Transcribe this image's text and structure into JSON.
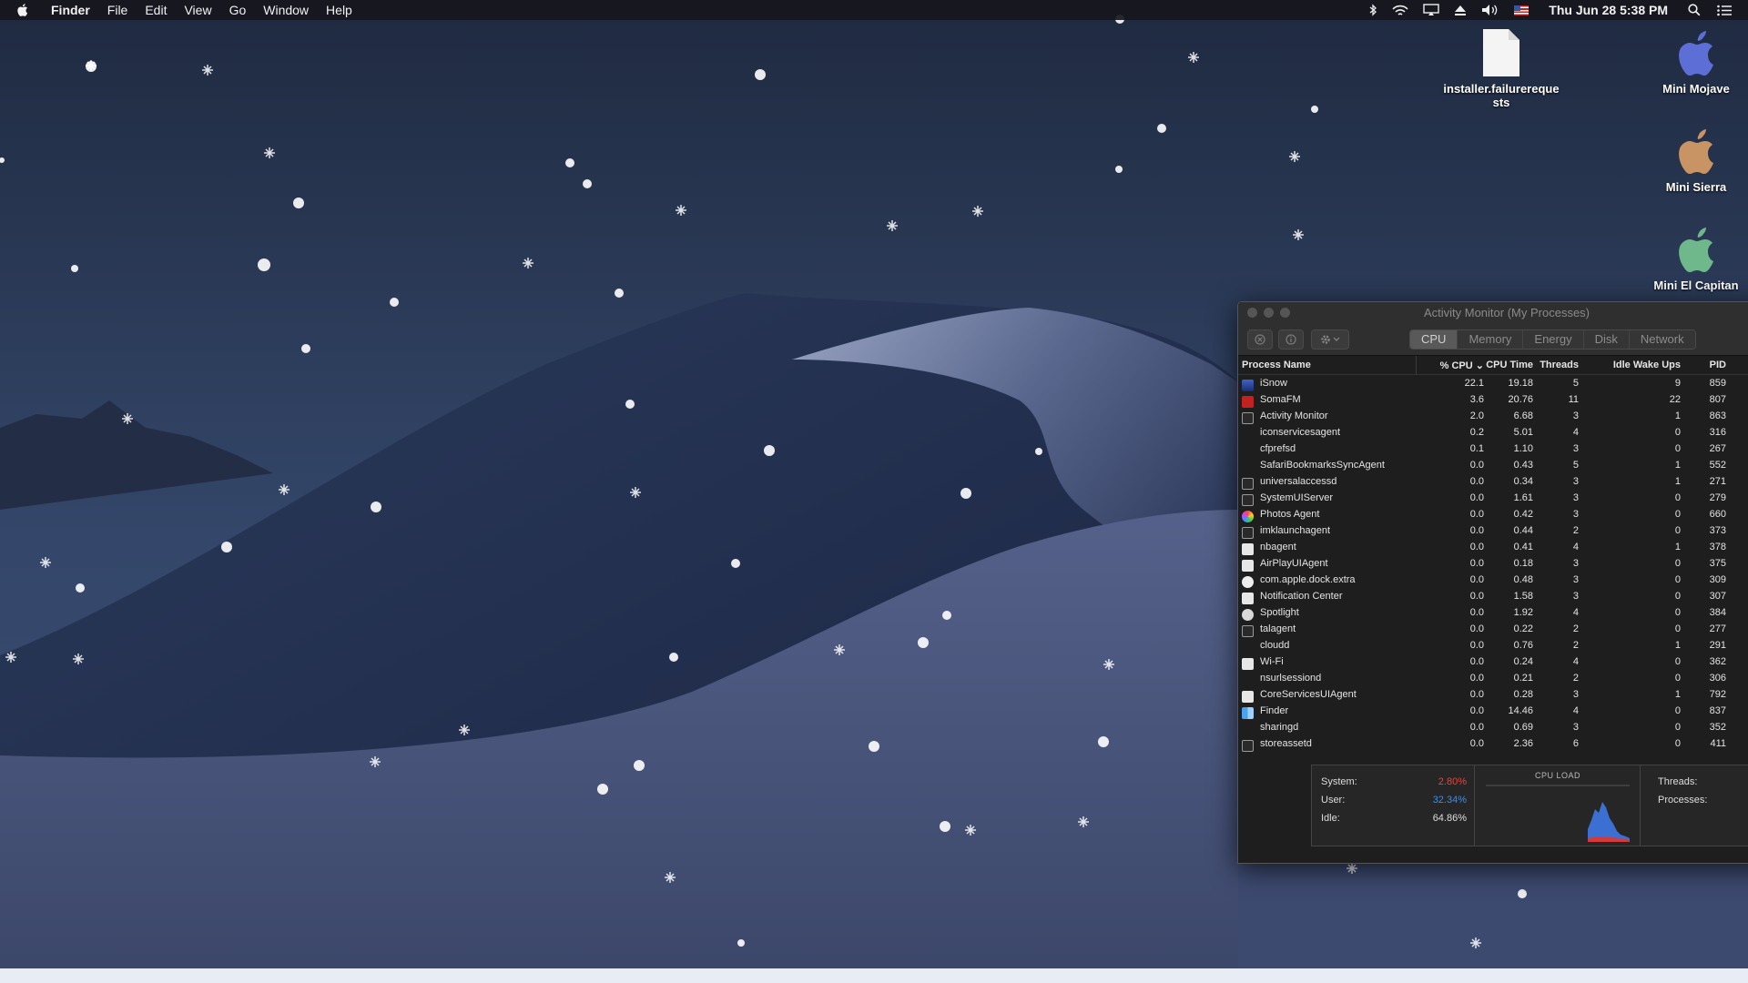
{
  "menubar": {
    "app_name": "Finder",
    "menus": [
      "File",
      "Edit",
      "View",
      "Go",
      "Window",
      "Help"
    ],
    "clock": "Thu Jun 28  5:38 PM"
  },
  "desktop": {
    "icons": [
      {
        "label": "installer.failurerequests",
        "kind": "document"
      },
      {
        "label": "Mini Mojave",
        "color": "#5d6fd6"
      },
      {
        "label": "Mini Sierra",
        "color": "#c99463"
      },
      {
        "label": "Mini El Capitan",
        "color": "#6fb88b"
      }
    ]
  },
  "activity_monitor": {
    "title": "Activity Monitor (My Processes)",
    "tabs": [
      "CPU",
      "Memory",
      "Energy",
      "Disk",
      "Network"
    ],
    "active_tab": "CPU",
    "columns": [
      "Process Name",
      "% CPU",
      "CPU Time",
      "Threads",
      "Idle Wake Ups",
      "PID"
    ],
    "sort_indicator": "⌄",
    "processes": [
      {
        "name": "iSnow",
        "cpu": "22.1",
        "time": "19.18",
        "threads": "5",
        "idle": "9",
        "pid": "859",
        "icon": "app-blue"
      },
      {
        "name": "SomaFM",
        "cpu": "3.6",
        "time": "20.76",
        "threads": "11",
        "idle": "22",
        "pid": "807",
        "icon": "app-red"
      },
      {
        "name": "Activity Monitor",
        "cpu": "2.0",
        "time": "6.68",
        "threads": "3",
        "idle": "1",
        "pid": "863",
        "icon": "window"
      },
      {
        "name": "iconservicesagent",
        "cpu": "0.2",
        "time": "5.01",
        "threads": "4",
        "idle": "0",
        "pid": "316",
        "icon": "none"
      },
      {
        "name": "cfprefsd",
        "cpu": "0.1",
        "time": "1.10",
        "threads": "3",
        "idle": "0",
        "pid": "267",
        "icon": "none"
      },
      {
        "name": "SafariBookmarksSyncAgent",
        "cpu": "0.0",
        "time": "0.43",
        "threads": "5",
        "idle": "1",
        "pid": "552",
        "icon": "none"
      },
      {
        "name": "universalaccessd",
        "cpu": "0.0",
        "time": "0.34",
        "threads": "3",
        "idle": "1",
        "pid": "271",
        "icon": "window"
      },
      {
        "name": "SystemUIServer",
        "cpu": "0.0",
        "time": "1.61",
        "threads": "3",
        "idle": "0",
        "pid": "279",
        "icon": "window"
      },
      {
        "name": "Photos Agent",
        "cpu": "0.0",
        "time": "0.42",
        "threads": "3",
        "idle": "0",
        "pid": "660",
        "icon": "photos"
      },
      {
        "name": "imklaunchagent",
        "cpu": "0.0",
        "time": "0.44",
        "threads": "2",
        "idle": "0",
        "pid": "373",
        "icon": "window"
      },
      {
        "name": "nbagent",
        "cpu": "0.0",
        "time": "0.41",
        "threads": "4",
        "idle": "1",
        "pid": "378",
        "icon": "doc"
      },
      {
        "name": "AirPlayUIAgent",
        "cpu": "0.0",
        "time": "0.18",
        "threads": "3",
        "idle": "0",
        "pid": "375",
        "icon": "doc"
      },
      {
        "name": "com.apple.dock.extra",
        "cpu": "0.0",
        "time": "0.48",
        "threads": "3",
        "idle": "0",
        "pid": "309",
        "icon": "shield"
      },
      {
        "name": "Notification Center",
        "cpu": "0.0",
        "time": "1.58",
        "threads": "3",
        "idle": "0",
        "pid": "307",
        "icon": "doc"
      },
      {
        "name": "Spotlight",
        "cpu": "0.0",
        "time": "1.92",
        "threads": "4",
        "idle": "0",
        "pid": "384",
        "icon": "spotlight"
      },
      {
        "name": "talagent",
        "cpu": "0.0",
        "time": "0.22",
        "threads": "2",
        "idle": "0",
        "pid": "277",
        "icon": "window"
      },
      {
        "name": "cloudd",
        "cpu": "0.0",
        "time": "0.76",
        "threads": "2",
        "idle": "1",
        "pid": "291",
        "icon": "none"
      },
      {
        "name": "Wi-Fi",
        "cpu": "0.0",
        "time": "0.24",
        "threads": "4",
        "idle": "0",
        "pid": "362",
        "icon": "doc"
      },
      {
        "name": "nsurlsessiond",
        "cpu": "0.0",
        "time": "0.21",
        "threads": "2",
        "idle": "0",
        "pid": "306",
        "icon": "none"
      },
      {
        "name": "CoreServicesUIAgent",
        "cpu": "0.0",
        "time": "0.28",
        "threads": "3",
        "idle": "1",
        "pid": "792",
        "icon": "doc"
      },
      {
        "name": "Finder",
        "cpu": "0.0",
        "time": "14.46",
        "threads": "4",
        "idle": "0",
        "pid": "837",
        "icon": "finder"
      },
      {
        "name": "sharingd",
        "cpu": "0.0",
        "time": "0.69",
        "threads": "3",
        "idle": "0",
        "pid": "352",
        "icon": "none"
      },
      {
        "name": "storeassetd",
        "cpu": "0.0",
        "time": "2.36",
        "threads": "6",
        "idle": "0",
        "pid": "411",
        "icon": "window"
      }
    ],
    "summary": {
      "system_label": "System:",
      "system_value": "2.80%",
      "system_color": "#e8443a",
      "user_label": "User:",
      "user_value": "32.34%",
      "user_color": "#3b8cf5",
      "idle_label": "Idle:",
      "idle_value": "64.86%",
      "cpu_load_title": "CPU LOAD",
      "threads_label": "Threads:",
      "processes_label": "Processes:"
    }
  }
}
